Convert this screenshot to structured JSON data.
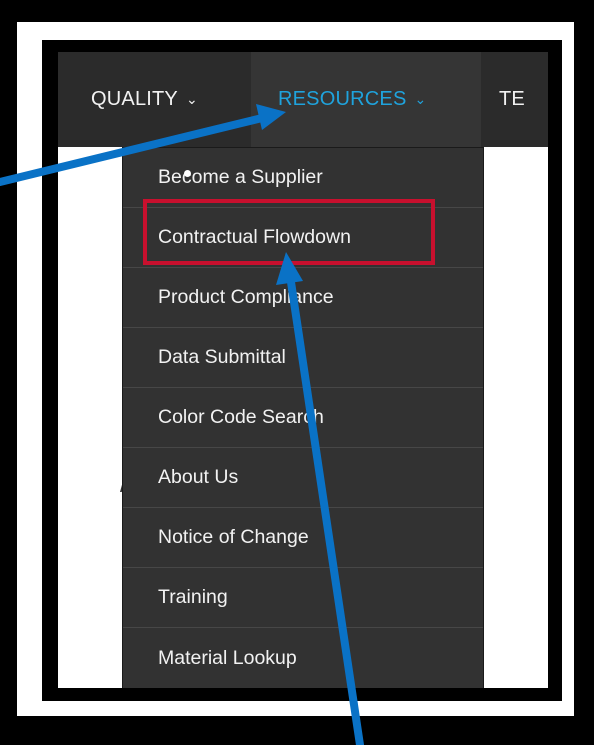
{
  "nav": {
    "quality_label": "QUALITY",
    "resources_label": "RESOURCES",
    "te_label": "TE",
    "chevron": "⌄"
  },
  "resources_menu": {
    "items": [
      {
        "label": "Become a Supplier"
      },
      {
        "label": "Contractual Flowdown"
      },
      {
        "label": "Product Compliance"
      },
      {
        "label": "Data Submittal"
      },
      {
        "label": "Color Code Search"
      },
      {
        "label": "About Us"
      },
      {
        "label": "Notice of Change"
      },
      {
        "label": "Training"
      },
      {
        "label": "Material Lookup"
      }
    ],
    "highlighted_index": 1
  },
  "colors": {
    "nav_bg": "#2b2b2b",
    "nav_active_bg": "#353535",
    "nav_active_text": "#1fa3dd",
    "menu_bg": "#323232",
    "highlight": "#c8102e",
    "annotation_arrow": "#0a72c6"
  },
  "icons": {
    "chevron": "chevron-down-icon",
    "arrow": "annotation-arrow-icon",
    "cursor": "cursor-dot-icon"
  }
}
